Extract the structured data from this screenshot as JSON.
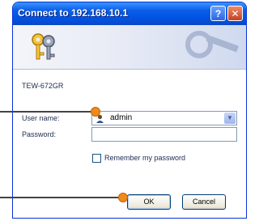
{
  "window": {
    "title": "Connect to 192.168.10.1",
    "help_glyph": "?",
    "close_glyph": "✕"
  },
  "dialog": {
    "site_name": "TEW-672GR",
    "username_label": "User name:",
    "username_value": "admin",
    "password_label": "Password:",
    "password_value": "",
    "remember_label": "Remember my password",
    "remember_checked": false,
    "ok_label": "OK",
    "cancel_label": "Cancel"
  },
  "icons": {
    "banner": "keys-icon",
    "user": "user-avatar-icon",
    "dropdown": "chevron-down-icon"
  },
  "colors": {
    "titlebar": "#0053e1",
    "callout": "#f08a1e"
  }
}
